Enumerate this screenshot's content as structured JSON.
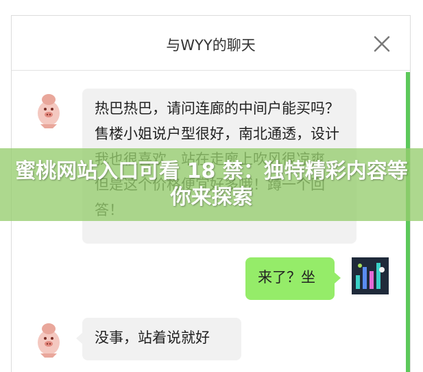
{
  "header": {
    "title": "与WYY的聊天"
  },
  "messages": [
    {
      "sender": "other",
      "avatar": "pig-avatar-icon",
      "text": "热巴热巴，请问连廊的中间户能买吗？售楼小姐说户型很好，南北通透，设计我也很喜欢，站在走廊上吹风很凉爽，但是这个价格便宜好多哦！蹲一个回答！"
    },
    {
      "sender": "me",
      "avatar": "abstract-art-avatar",
      "text": "来了？坐"
    },
    {
      "sender": "other",
      "avatar": "pig-avatar-icon",
      "text": "没事，站着说就好"
    }
  ],
  "overlay": {
    "banner_text": "蜜桃网站入口可看 18 禁：独特精彩内容等你来探索"
  },
  "colors": {
    "my_bubble": "#95ec69",
    "other_bubble": "#f1f1f1",
    "scrollbar": "#5cc95a",
    "banner": "#96cd6e"
  }
}
